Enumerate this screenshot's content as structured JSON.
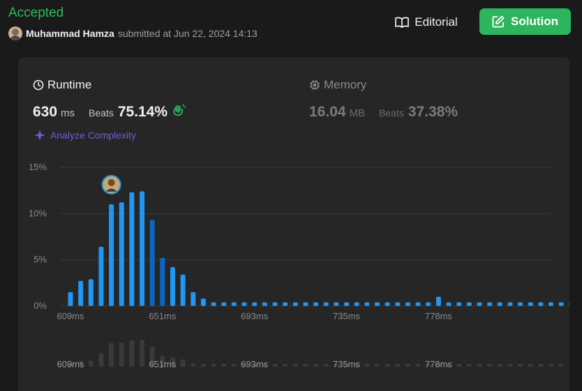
{
  "header": {
    "status": "Accepted",
    "username": "Muhammad Hamza",
    "submitted_text": "submitted at Jun 22, 2024 14:13",
    "editorial_label": "Editorial",
    "solution_label": "Solution"
  },
  "runtime": {
    "title": "Runtime",
    "value": "630",
    "unit": "ms",
    "beats_label": "Beats",
    "beats_value": "75.14%"
  },
  "memory": {
    "title": "Memory",
    "value": "16.04",
    "unit": "MB",
    "beats_label": "Beats",
    "beats_value": "37.38%"
  },
  "analyze_label": "Analyze Complexity",
  "colors": {
    "accepted": "#2cbb5d",
    "solution_button": "#2db55d",
    "bar": "#2196f3",
    "bar_highlight": "#0a66c2",
    "overview_bar": "#3a3a3a",
    "analyze": "#6c5fd6"
  },
  "chart_data": {
    "type": "bar",
    "xlabel": "",
    "ylabel": "",
    "ylim": [
      0,
      15
    ],
    "y_ticks": [
      "0%",
      "5%",
      "10%",
      "15%"
    ],
    "x_tick_labels": [
      "609ms",
      "651ms",
      "693ms",
      "735ms",
      "778ms"
    ],
    "your_submission_index": 4,
    "highlight_range": [
      8,
      9
    ],
    "values": [
      1.5,
      2.7,
      2.9,
      6.4,
      11.0,
      11.2,
      12.3,
      12.4,
      9.3,
      5.2,
      4.2,
      3.4,
      1.5,
      0.8,
      0.4,
      0.4,
      0.4,
      0.4,
      0.4,
      0.4,
      0.4,
      0.4,
      0.4,
      0.4,
      0.4,
      0.4,
      0.4,
      0.4,
      0.4,
      0.4,
      0.4,
      0.4,
      0.4,
      0.4,
      0.4,
      0.4,
      1.0,
      0.4,
      0.4,
      0.4,
      0.4,
      0.4,
      0.4,
      0.4,
      0.4,
      0.4,
      0.4,
      0.4,
      0.4,
      0.4
    ],
    "overview_x_tick_labels": [
      "609ms",
      "651ms",
      "693ms",
      "735ms",
      "778ms"
    ]
  }
}
